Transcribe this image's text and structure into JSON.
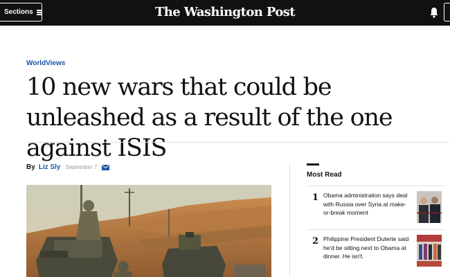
{
  "header": {
    "sections_label": "Sections",
    "logo_text": "The Washington Post"
  },
  "article": {
    "kicker": "WorldViews",
    "headline": "10 new wars that could be unleashed as a result of the one against ISIS",
    "byline_prefix": "By",
    "author": "Liz Sly",
    "date": "September 7"
  },
  "most_read": {
    "title": "Most Read",
    "items": [
      {
        "rank": "1",
        "text": "Obama administration says deal with Russia over Syria at make-or-break moment"
      },
      {
        "rank": "2",
        "text": "Philippine President Duterte said he'd be sitting next to Obama at dinner. He isn't."
      }
    ]
  },
  "colors": {
    "topbar": "#111111",
    "link_blue": "#1955a5",
    "rule": "#e0e0e0"
  },
  "icons": [
    "hamburger-icon",
    "bell-icon",
    "mail-icon"
  ]
}
